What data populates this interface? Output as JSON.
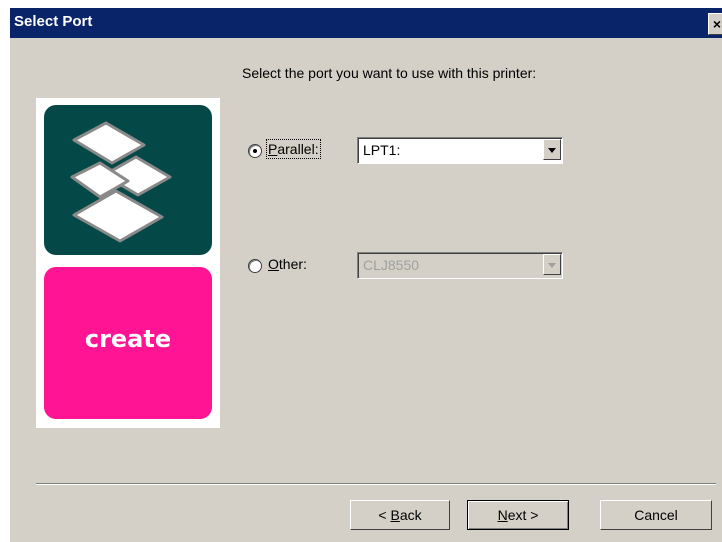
{
  "window": {
    "title": "Select Port",
    "close_label": "×"
  },
  "instruction": "Select the port you want to use with this printer:",
  "logo": {
    "text": "create"
  },
  "ports": {
    "parallel": {
      "label_mnemonic": "P",
      "label_rest": "arallel:",
      "selected": true,
      "value": "LPT1:"
    },
    "other": {
      "label_mnemonic": "O",
      "label_rest": "ther:",
      "selected": false,
      "value": "CLJ8550",
      "disabled": true
    }
  },
  "buttons": {
    "back": {
      "prefix": "< ",
      "mnemonic": "B",
      "rest": "ack"
    },
    "next": {
      "mnemonic": "N",
      "rest": "ext >"
    },
    "cancel": "Cancel"
  },
  "colors": {
    "titlebar": "#0a246a",
    "dialog_bg": "#d4d0c8",
    "logo_top": "#054848",
    "logo_bottom": "#ff1493"
  }
}
